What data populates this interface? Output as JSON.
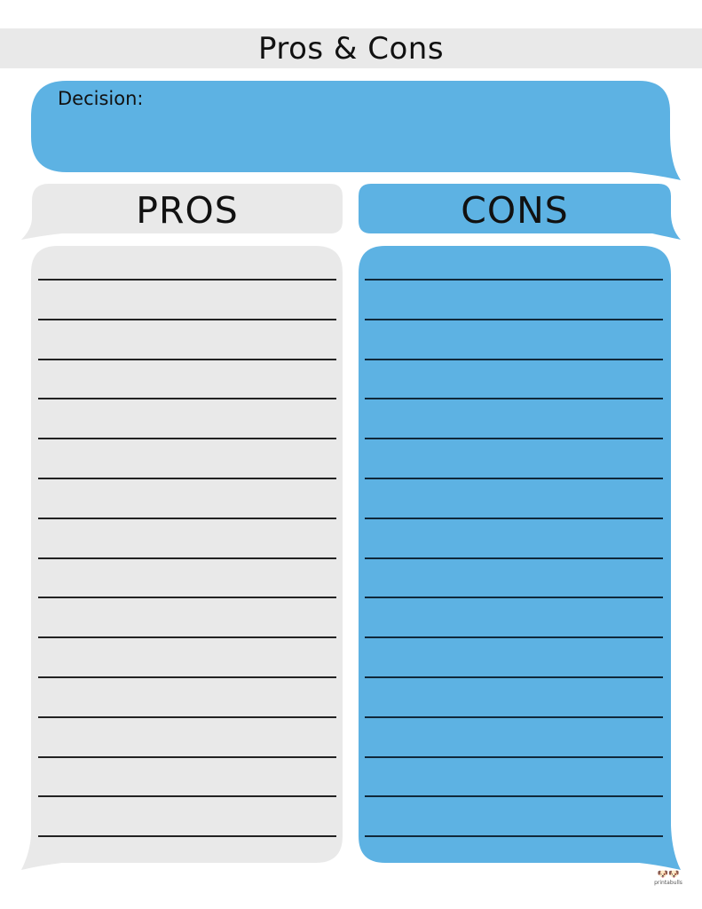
{
  "page": {
    "title": "Pros & Cons",
    "decision_label": "Decision:",
    "decision_value": "",
    "pros": {
      "label": "PROS",
      "lines": 15,
      "color": "#e9e9e9"
    },
    "cons": {
      "label": "CONS",
      "lines": 15,
      "color": "#5db2e3"
    },
    "logo": {
      "icon": "dogs-icon",
      "glyph": "🐶🐶",
      "text": "printabulls"
    }
  },
  "colors": {
    "accent": "#5db2e3",
    "neutral": "#e9e9e9",
    "line": "#222222"
  }
}
